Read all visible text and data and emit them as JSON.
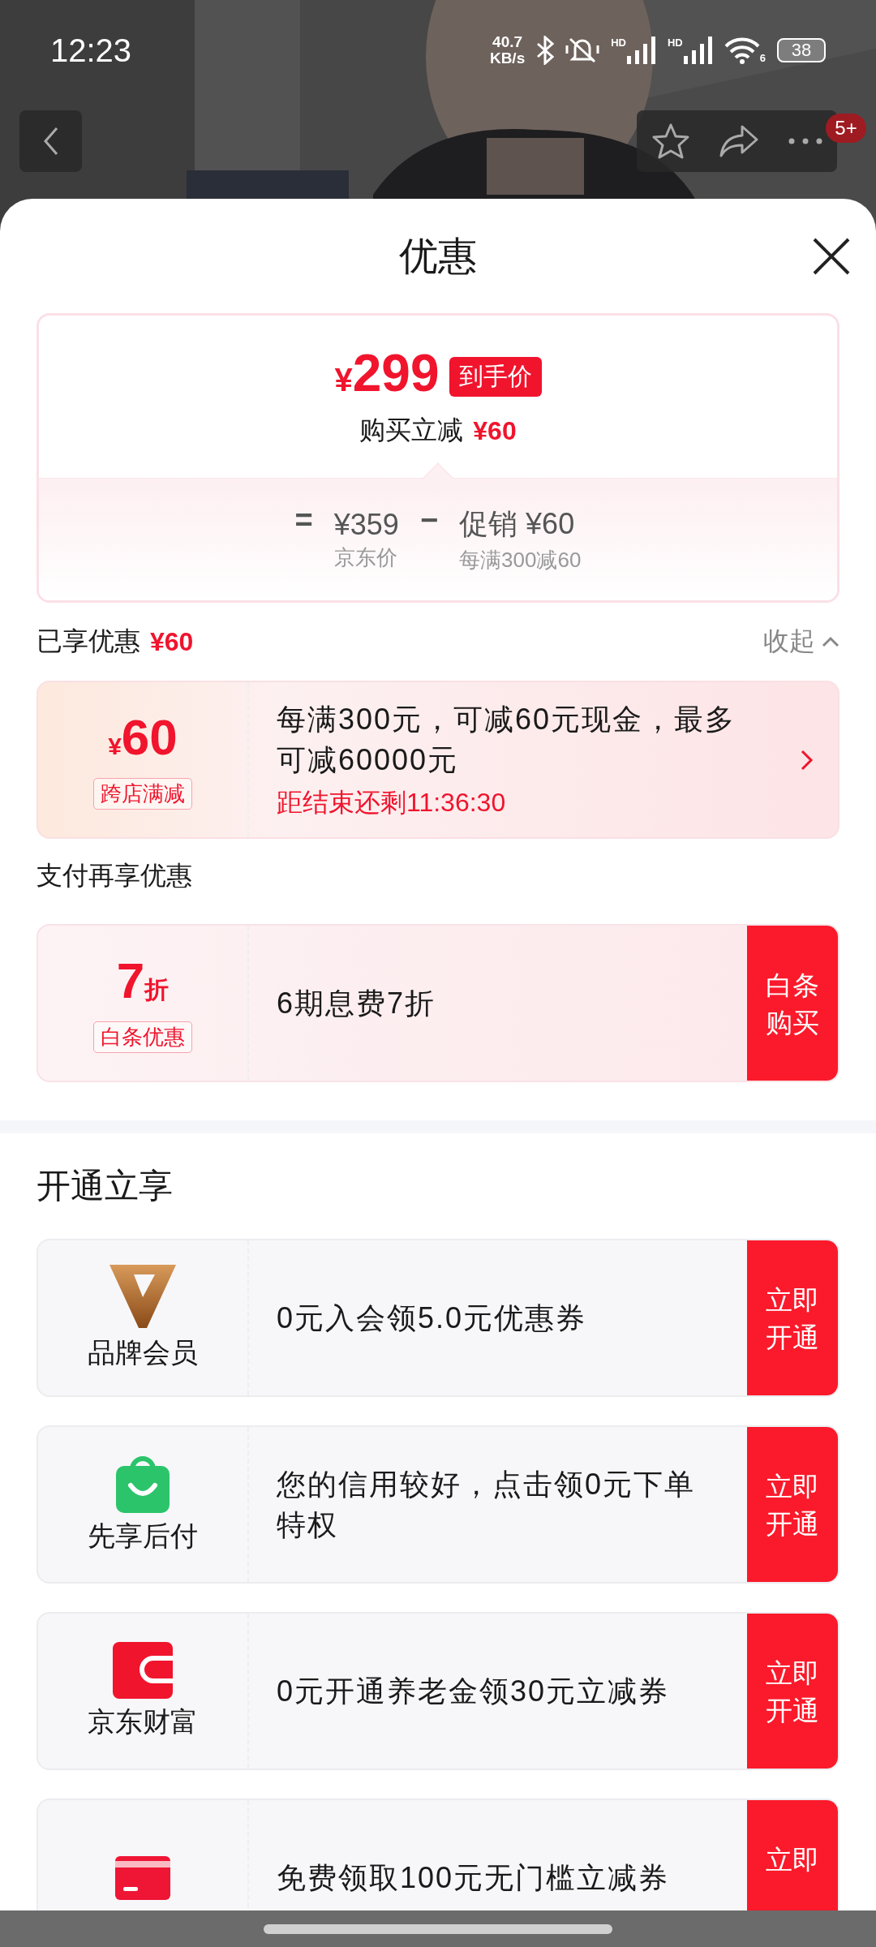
{
  "status_bar": {
    "time": "12:23",
    "net_speed": [
      "40.7",
      "KB/s"
    ],
    "signal_labels": [
      "HD",
      "HD"
    ],
    "wifi_label": "6",
    "battery": "38"
  },
  "header": {
    "badge": "5+"
  },
  "sheet": {
    "title": "优惠"
  },
  "price": {
    "currency": "¥",
    "amount": "299",
    "tag": "到手价",
    "reduction_label": "购买立减",
    "reduction": "¥60",
    "equals": "=",
    "original": "¥359",
    "original_label": "京东价",
    "minus": "−",
    "promo": "促销 ¥60",
    "promo_note": "每满300减60"
  },
  "enjoyed": {
    "label": "已享优惠",
    "amount": "¥60",
    "collapse": "收起"
  },
  "offers": [
    {
      "currency": "¥",
      "amount": "60",
      "tag": "跨店满减",
      "description": "每满300元，可减60元现金，最多可减60000元",
      "countdown": "距结束还剩11:36:30"
    }
  ],
  "pay_section": {
    "title": "支付再享优惠",
    "offers": [
      {
        "amount": "7",
        "unit": "折",
        "tag": "白条优惠",
        "description": "6期息费7折",
        "button": "白条购买"
      }
    ]
  },
  "open_section": {
    "title": "开通立享",
    "items": [
      {
        "kind": "brand",
        "name": "品牌会员",
        "description": "0元入会领5.0元优惠券",
        "button": "立即开通"
      },
      {
        "kind": "bag",
        "name": "先享后付",
        "description": "您的信用较好，点击领0元下单特权",
        "button": "立即开通"
      },
      {
        "kind": "wallet",
        "name": "京东财富",
        "description": "0元开通养老金领30元立减券",
        "button": "立即开通"
      },
      {
        "kind": "card",
        "description": "免费领取100元无门槛立减券",
        "button": "立即"
      }
    ]
  }
}
